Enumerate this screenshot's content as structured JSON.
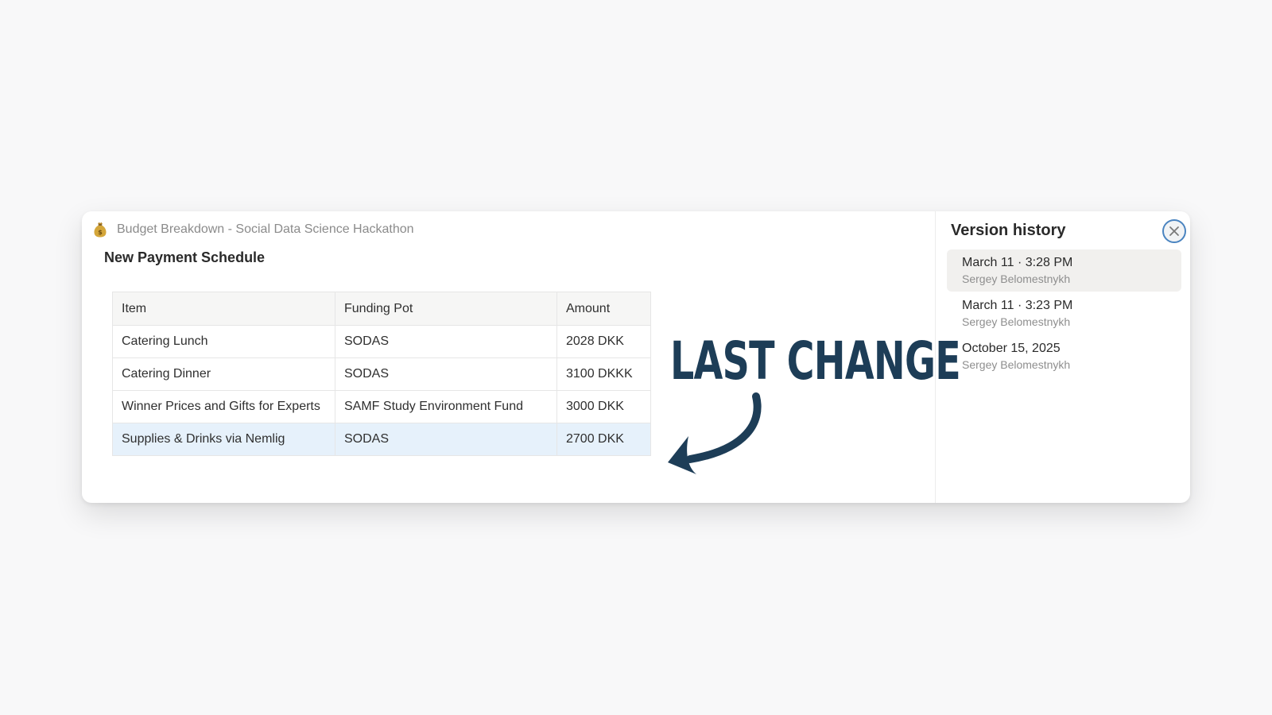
{
  "document": {
    "breadcrumb_icon": "money-bag-icon",
    "breadcrumb_title": "Budget Breakdown - Social Data Science Hackathon",
    "page_title": "New Payment Schedule"
  },
  "table": {
    "headers": [
      "Item",
      "Funding Pot",
      "Amount"
    ],
    "rows": [
      {
        "item": "Catering Lunch",
        "pot": "SODAS",
        "amount": "2028 DKK"
      },
      {
        "item": "Catering Dinner",
        "pot": "SODAS",
        "amount": "3100 DKKK"
      },
      {
        "item": "Winner Prices and Gifts for Experts",
        "pot": "SAMF Study Environment Fund",
        "amount": "3000 DKK"
      },
      {
        "item": "Supplies & Drinks via Nemlig",
        "pot": "SODAS",
        "amount": "2700 DKK"
      }
    ],
    "highlighted_row": 3,
    "highlight_color": "#e6f1fb"
  },
  "annotation": {
    "text": "LAST CHANGE",
    "color": "#1d3d57",
    "arrow_icon": "curved-arrow-icon"
  },
  "version_history": {
    "title": "Version history",
    "close_icon": "close-icon",
    "versions": [
      {
        "date": "March 11 · 3:28 PM",
        "author": "Sergey Belomestnykh",
        "selected": true
      },
      {
        "date": "March 11 · 3:23 PM",
        "author": "Sergey Belomestnykh",
        "selected": false
      },
      {
        "date": "October 15, 2025",
        "author": "Sergey Belomestnykh",
        "selected": false
      }
    ]
  }
}
